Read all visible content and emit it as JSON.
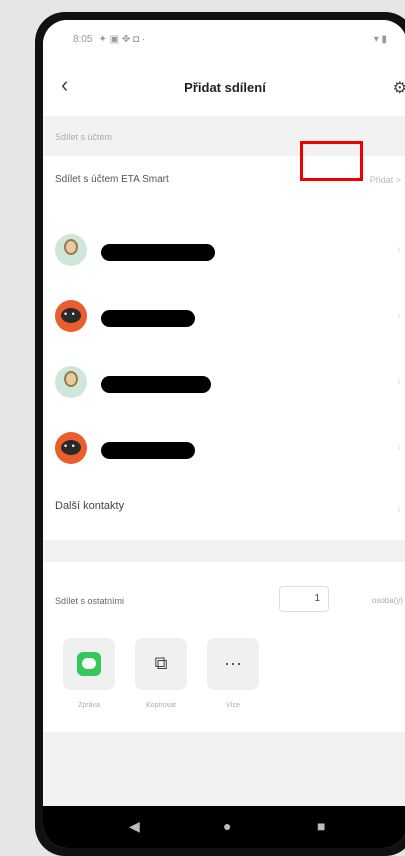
{
  "status": {
    "time": "8:05",
    "icons_left": "✦ ▣ ✥ ◘ ·",
    "icons_right": "▾ ▮"
  },
  "header": {
    "back": "‹",
    "title": "Přidat sdílení",
    "settings_icon": "gear-icon"
  },
  "section_account": {
    "caption": "Sdílet s účtem"
  },
  "share_row": {
    "label": "Sdílet s účtem ETA Smart",
    "action": "Přidat >"
  },
  "contacts": [
    {
      "avatar": "person",
      "chevron": "›"
    },
    {
      "avatar": "robot",
      "chevron": "›"
    },
    {
      "avatar": "person",
      "chevron": "›"
    },
    {
      "avatar": "robot",
      "chevron": "›"
    }
  ],
  "more_contacts": {
    "label": "Další kontakty",
    "chevron": "›"
  },
  "share_others": {
    "label": "Sdílet s ostatními",
    "count": "1",
    "unit": "osoba(y)"
  },
  "share_options": [
    {
      "label": "Zpráva",
      "icon": "message-icon"
    },
    {
      "label": "Kopírovat",
      "icon": "copy-icon",
      "glyph": "⧉"
    },
    {
      "label": "Více",
      "icon": "more-icon",
      "glyph": "···"
    }
  ],
  "android_nav": {
    "back": "◀",
    "home": "●",
    "recents": "■"
  },
  "colors": {
    "highlight": "#e00000",
    "sms_green": "#34c759"
  }
}
